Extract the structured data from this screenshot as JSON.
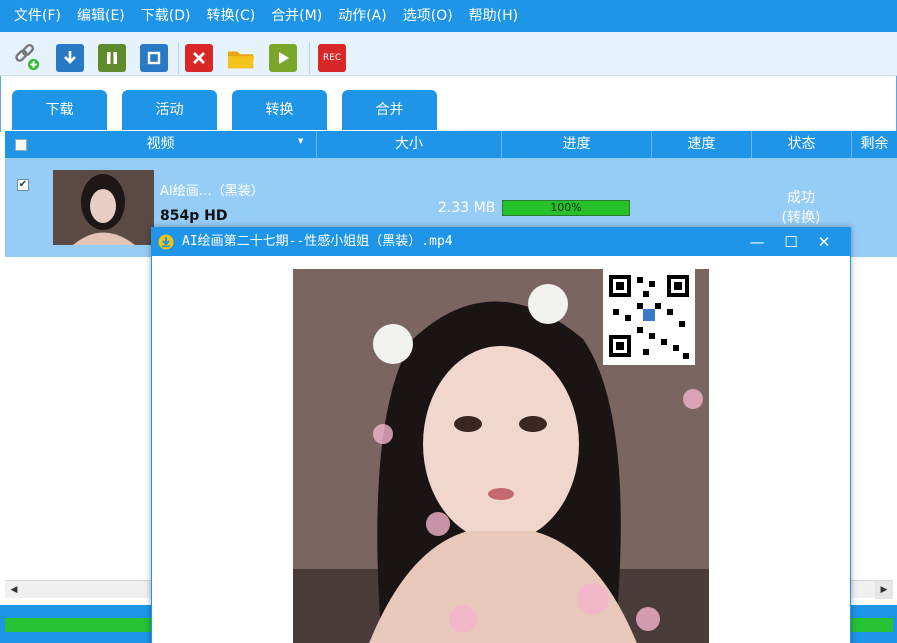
{
  "menu": [
    "文件(F)",
    "编辑(E)",
    "下载(D)",
    "转换(C)",
    "合并(M)",
    "动作(A)",
    "选项(O)",
    "帮助(H)"
  ],
  "toolbar": {
    "icons": [
      "add-link-icon",
      "download-icon",
      "pause-icon",
      "stop-icon",
      "delete-icon",
      "open-folder-icon",
      "play-icon",
      "record-icon"
    ],
    "rec_label": "REC"
  },
  "tabs": [
    "下载",
    "活动",
    "转换",
    "合并"
  ],
  "table": {
    "columns": [
      "视频",
      "大小",
      "进度",
      "速度",
      "状态",
      "剩余"
    ],
    "rows": [
      {
        "checked": true,
        "title": "AI绘画…（黑装）",
        "resolution": "854p HD",
        "size": "2.33 MB",
        "progress_label": "100%",
        "progress": 1.0,
        "status_line1": "成功",
        "status_line2": "(转换)"
      }
    ]
  },
  "player": {
    "title": "AI绘画第二十七期--性感小姐姐（黑装）.mp4",
    "minimize": "—",
    "maximize": "☐",
    "close": "✕"
  },
  "colors": {
    "accent": "#1f95e8",
    "row_selected": "#96cdf6",
    "progress_green": "#26c12a"
  }
}
